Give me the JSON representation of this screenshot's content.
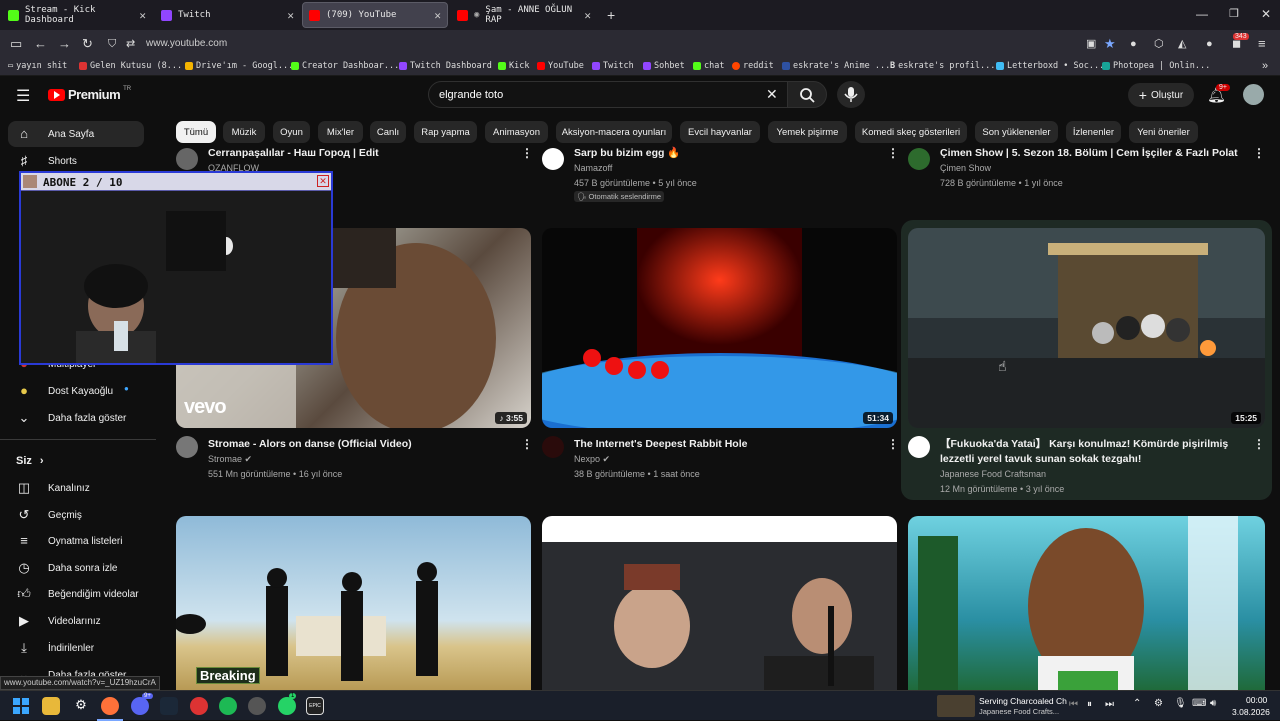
{
  "tabs": [
    {
      "label": "Stream - Kick Dashboard",
      "active": false
    },
    {
      "label": "Twitch",
      "active": false
    },
    {
      "label": "(709) YouTube",
      "active": true
    },
    {
      "label": "Şam - ANNE OĞLUN RAP",
      "active": false
    }
  ],
  "browser": {
    "url": "www.youtube.com",
    "notification_count": "343"
  },
  "bookmarks": [
    "yayın shit",
    "Gelen Kutusu (8...",
    "Drive'ım - Googl...",
    "Creator Dashboar...",
    "Twitch Dashboard",
    "Kick",
    "YouTube",
    "Twitch",
    "Sohbet",
    "chat",
    "reddit",
    "eskrate's Anime ...",
    "eskrate's profil...",
    "Letterboxd • Soc...",
    "Photopea | Onlin..."
  ],
  "youtube": {
    "logo": "Premium",
    "logo_region": "TR",
    "search_value": "elgrande toto",
    "create_label": "Oluştur",
    "notif_badge": "9+"
  },
  "chips": [
    "Tümü",
    "Müzik",
    "Oyun",
    "Mix'ler",
    "Canlı",
    "Rap yapma",
    "Animasyon",
    "Aksiyon-macera oyunları",
    "Evcil hayvanlar",
    "Yemek pişirme",
    "Komedi skeç gösterileri",
    "Son yüklenenler",
    "İzlenenler",
    "Yeni öneriler"
  ],
  "sidebar": {
    "home": "Ana Sayfa",
    "shorts": "Shorts",
    "partial_item": "Multiplayer",
    "dost": "Dost Kayaoğlu",
    "show_more": "Daha fazla göster",
    "you": "Siz",
    "you_items": [
      "Kanalınız",
      "Geçmiş",
      "Oynatma listeleri",
      "Daha sonra izle",
      "Beğendiğim videolar",
      "Videolarınız",
      "İndirilenler",
      "Daha fazla göster"
    ]
  },
  "top_row": [
    {
      "title": "Cerranpaşalılar - Наш Город | Edit",
      "channel": "OZANFLOW",
      "meta": ""
    },
    {
      "title": "Sarp bu bizim egg 🔥",
      "channel": "Namazoff",
      "meta": "457 B görüntüleme • 5 yıl önce",
      "badge": "Otomatik seslendirme"
    },
    {
      "title": "Çimen Show | 5. Sezon 18. Bölüm | Cem İşçiler & Fazlı Polat",
      "channel": "Çimen Show",
      "meta": "728 B görüntüleme • 1 yıl önce"
    }
  ],
  "mid_row": [
    {
      "title": "Stromae - Alors on danse (Official Video)",
      "channel": "Stromae",
      "meta": "551 Mn görüntüleme • 16 yıl önce",
      "duration": "3:55",
      "brand": "vevo"
    },
    {
      "title": "The Internet's Deepest Rabbit Hole",
      "channel": "Nexpo",
      "meta": "38 B görüntüleme • 1 saat önce",
      "duration": "51:34"
    },
    {
      "title1": "【Fukuoka'da Yatai】 Karşı konulmaz! Kömürde pişirilmiş",
      "title2": "lezzetli yerel tavuk sunan sokak tezgahı!",
      "channel": "Japanese Food Craftsman",
      "meta": "12 Mn görüntüleme • 3 yıl önce",
      "duration": "15:25"
    }
  ],
  "bottom_row": [
    {
      "caption": "Breaking"
    }
  ],
  "overlay": {
    "title": "ABONE 2 / 10"
  },
  "status_url": "www.youtube.com/watch?v=_UZ19hzuCrA",
  "taskbar": {
    "media_title": "Serving Charcoaled Ch",
    "media_sub": "Japanese Food Crafts...",
    "time": "00:00",
    "date": "3.08.2026",
    "discord_badge": "9+",
    "whatsapp_badge": "1"
  },
  "colors": {
    "yt_red": "#ff0000",
    "kick_green": "#53fc18",
    "twitch_purple": "#9146ff",
    "overlay_border": "#2a3ad6"
  }
}
